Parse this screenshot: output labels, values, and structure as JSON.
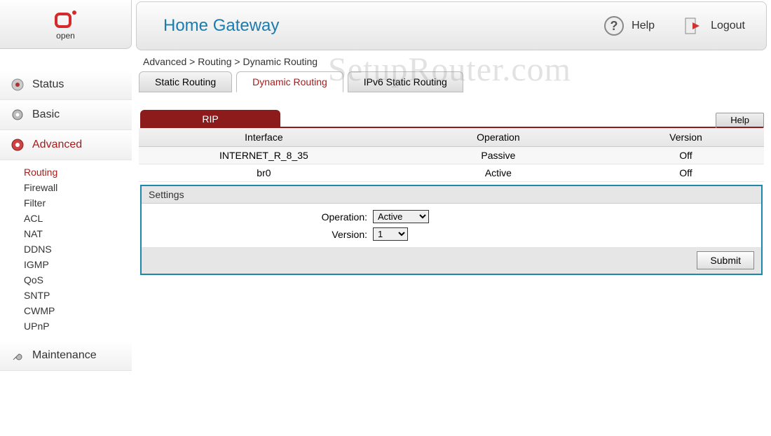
{
  "logo": {
    "text": "open"
  },
  "header": {
    "title": "Home Gateway",
    "help_label": "Help",
    "logout_label": "Logout"
  },
  "breadcrumb": {
    "part1": "Advanced",
    "part2": "Routing",
    "part3": "Dynamic Routing",
    "sep": " > "
  },
  "tabs": [
    {
      "label": "Static Routing",
      "active": false
    },
    {
      "label": "Dynamic Routing",
      "active": true
    },
    {
      "label": "IPv6 Static Routing",
      "active": false
    }
  ],
  "nav": {
    "status": "Status",
    "basic": "Basic",
    "advanced": "Advanced",
    "maintenance": "Maintenance"
  },
  "sub_nav": [
    "Routing",
    "Firewall",
    "Filter",
    "ACL",
    "NAT",
    "DDNS",
    "IGMP",
    "QoS",
    "SNTP",
    "CWMP",
    "UPnP"
  ],
  "panel": {
    "tab_label": "RIP",
    "help_label": "Help",
    "columns": {
      "c1": "Interface",
      "c2": "Operation",
      "c3": "Version"
    },
    "rows": [
      {
        "iface": "INTERNET_R_8_35",
        "op": "Passive",
        "ver": "Off"
      },
      {
        "iface": "br0",
        "op": "Active",
        "ver": "Off"
      }
    ],
    "settings_title": "Settings",
    "operation_label": "Operation:",
    "version_label": "Version:",
    "operation_value": "Active",
    "version_value": "1",
    "submit_label": "Submit"
  },
  "watermark": "SetupRouter.com"
}
